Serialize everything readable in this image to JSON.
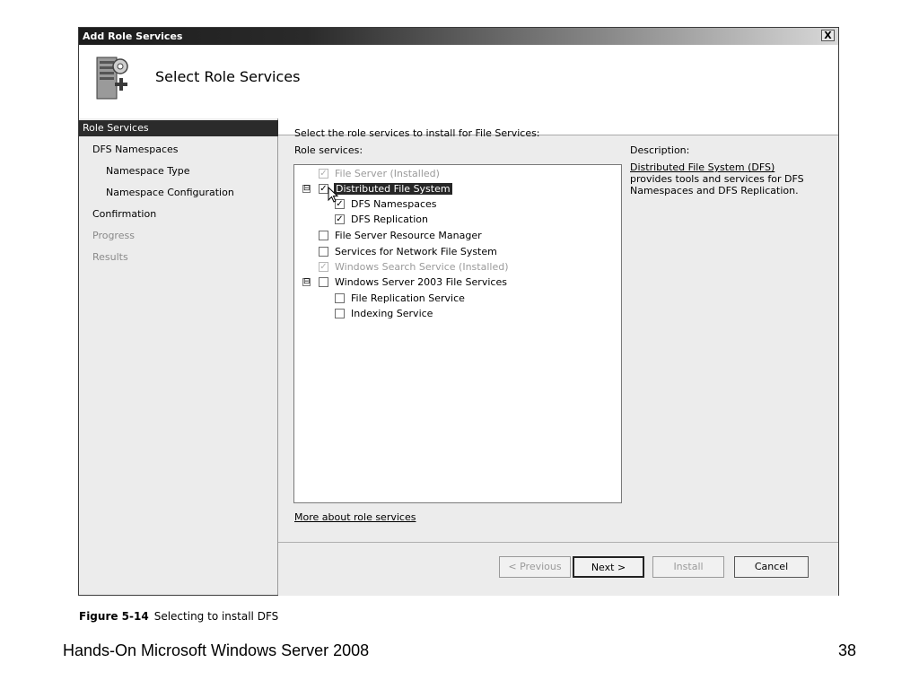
{
  "window": {
    "title": "Add Role Services",
    "close_glyph": "X",
    "header_title": "Select Role Services",
    "header_icon": "server-add-icon"
  },
  "sidebar": {
    "items": [
      {
        "label": "Role Services",
        "state": "active"
      },
      {
        "label": "DFS Namespaces",
        "state": "normal"
      },
      {
        "label": "Namespace Type",
        "state": "normal"
      },
      {
        "label": "Namespace Configuration",
        "state": "normal"
      },
      {
        "label": "Confirmation",
        "state": "normal"
      },
      {
        "label": "Progress",
        "state": "disabled"
      },
      {
        "label": "Results",
        "state": "disabled"
      }
    ]
  },
  "main": {
    "instruction": "Select the role services to install for File Services:",
    "role_services_label": "Role services:",
    "description_label": "Description:",
    "description_link": "Distributed File System (DFS)",
    "description_text": " provides tools and services for DFS Namespaces and DFS Replication.",
    "more_link": "More about role services",
    "tree": [
      {
        "label": "File Server  (Installed)",
        "checked": true,
        "disabled": true
      },
      {
        "label": "Distributed File System",
        "checked": true,
        "disabled": false,
        "selected": true,
        "expander": "⊟"
      },
      {
        "label": "DFS Namespaces",
        "checked": true,
        "disabled": false
      },
      {
        "label": "DFS Replication",
        "checked": true,
        "disabled": false
      },
      {
        "label": "File Server Resource Manager",
        "checked": false,
        "disabled": false
      },
      {
        "label": "Services for Network File System",
        "checked": false,
        "disabled": false
      },
      {
        "label": "Windows Search Service  (Installed)",
        "checked": true,
        "disabled": true
      },
      {
        "label": "Windows Server 2003 File Services",
        "checked": false,
        "disabled": false,
        "expander": "⊟"
      },
      {
        "label": "File Replication Service",
        "checked": false,
        "disabled": false
      },
      {
        "label": "Indexing Service",
        "checked": false,
        "disabled": false
      }
    ]
  },
  "buttons": {
    "previous": "< Previous",
    "next": "Next >",
    "install": "Install",
    "cancel": "Cancel"
  },
  "caption": {
    "figure": "Figure 5-14",
    "text": "Selecting to install DFS"
  },
  "slide": {
    "footer": "Hands-On Microsoft Windows Server 2008",
    "page": "38"
  }
}
